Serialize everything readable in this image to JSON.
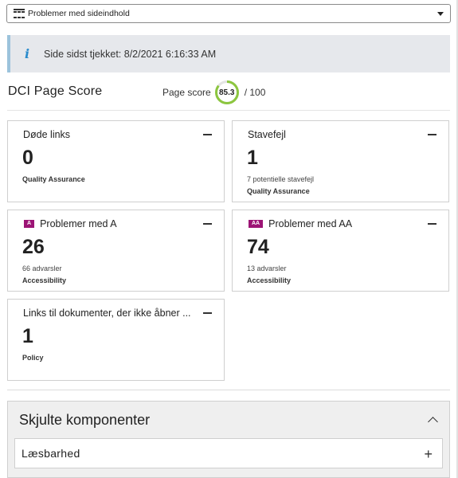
{
  "filter": {
    "selected": "Problemer med sideindhold",
    "icon": "table-icon"
  },
  "info": {
    "icon": "info-icon",
    "text": "Side sidst tjekket: 8/2/2021 6:16:33 AM"
  },
  "score": {
    "title": "DCI Page Score",
    "label": "Page score",
    "value": "85.3",
    "max": "/ 100",
    "fraction": 0.853,
    "color": "#8cc63f"
  },
  "cards": [
    {
      "title": "Døde links",
      "value": "0",
      "sub": "",
      "category": "Quality Assurance"
    },
    {
      "title": "Stavefejl",
      "value": "1",
      "sub": "7 potentielle stavefejl",
      "category": "Quality Assurance"
    },
    {
      "badge": "A",
      "title": "Problemer med A",
      "value": "26",
      "sub": "66 advarsler",
      "category": "Accessibility"
    },
    {
      "badge": "AA",
      "title": "Problemer med AA",
      "value": "74",
      "sub": "13 advarsler",
      "category": "Accessibility"
    },
    {
      "title": "Links til dokumenter, der ikke åbner ...",
      "value": "1",
      "sub": "",
      "category": "Policy"
    }
  ],
  "badge_color": "#9c1475",
  "hidden": {
    "title": "Skjulte komponenter",
    "items": [
      {
        "label": "Læsbarhed"
      }
    ]
  }
}
